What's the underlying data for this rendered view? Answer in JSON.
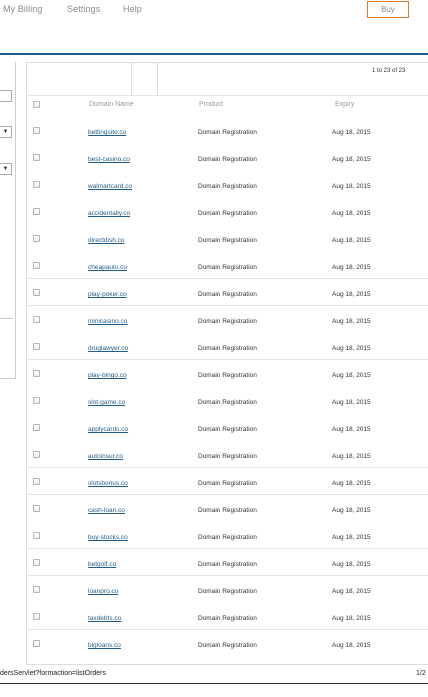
{
  "nav": {
    "items": [
      "My Billing",
      "Settings",
      "Help"
    ],
    "buy_label": "Buy"
  },
  "sidebar": {
    "select_arrow": "▼"
  },
  "table": {
    "pager": "1 to 23 of 23",
    "headers": {
      "domain": "Domain Name",
      "product": "Product",
      "expiry": "Expiry"
    },
    "rows": [
      {
        "domain": "bettingsite.co",
        "product": "Domain Registration",
        "expiry": "Aug 18, 2015"
      },
      {
        "domain": "best-casino.co",
        "product": "Domain Registration",
        "expiry": "Aug 18, 2015"
      },
      {
        "domain": "walmartcard.co",
        "product": "Domain Registration",
        "expiry": "Aug 18, 2015"
      },
      {
        "domain": "accidentally.co",
        "product": "Domain Registration",
        "expiry": "Aug 18, 2015"
      },
      {
        "domain": "directdish.co",
        "product": "Domain Registration",
        "expiry": "Aug 18, 2015"
      },
      {
        "domain": "cheapauto.co",
        "product": "Domain Registration",
        "expiry": "Aug 18, 2015"
      },
      {
        "domain": "play-poker.co",
        "product": "Domain Registration",
        "expiry": "Aug 18, 2015"
      },
      {
        "domain": "minicasino.co",
        "product": "Domain Registration",
        "expiry": "Aug 18, 2015"
      },
      {
        "domain": "druglawyer.co",
        "product": "Domain Registration",
        "expiry": "Aug 18, 2015"
      },
      {
        "domain": "play-bingo.co",
        "product": "Domain Registration",
        "expiry": "Aug 18, 2015"
      },
      {
        "domain": "slot-game.co",
        "product": "Domain Registration",
        "expiry": "Aug 18, 2015"
      },
      {
        "domain": "applycards.co",
        "product": "Domain Registration",
        "expiry": "Aug 18, 2015"
      },
      {
        "domain": "autoinsur.co",
        "product": "Domain Registration",
        "expiry": "Aug 18, 2015"
      },
      {
        "domain": "slotsbonus.co",
        "product": "Domain Registration",
        "expiry": "Aug 18, 2015"
      },
      {
        "domain": "cash-loan.co",
        "product": "Domain Registration",
        "expiry": "Aug 18, 2015"
      },
      {
        "domain": "buy-stocks.co",
        "product": "Domain Registration",
        "expiry": "Aug 18, 2015"
      },
      {
        "domain": "betgolf.co",
        "product": "Domain Registration",
        "expiry": "Aug 18, 2015"
      },
      {
        "domain": "loanpro.co",
        "product": "Domain Registration",
        "expiry": "Aug 18, 2015"
      },
      {
        "domain": "taxdebts.co",
        "product": "Domain Registration",
        "expiry": "Aug 18, 2015"
      },
      {
        "domain": "bigloans.co",
        "product": "Domain Registration",
        "expiry": "Aug 18, 2015"
      }
    ]
  },
  "status": {
    "url": "dersServlet?formaction=listOrders",
    "page": "1/2"
  },
  "colors": {
    "accent": "#1f5c8b",
    "buy_border": "#e07a2a"
  }
}
